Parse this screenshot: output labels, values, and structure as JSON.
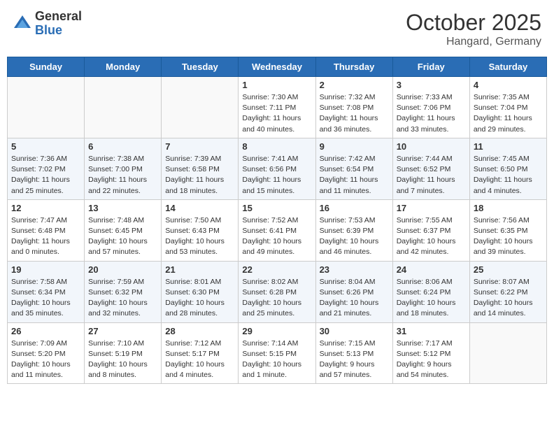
{
  "header": {
    "logo_general": "General",
    "logo_blue": "Blue",
    "month_title": "October 2025",
    "location": "Hangard, Germany"
  },
  "weekdays": [
    "Sunday",
    "Monday",
    "Tuesday",
    "Wednesday",
    "Thursday",
    "Friday",
    "Saturday"
  ],
  "weeks": [
    [
      {
        "day": "",
        "info": ""
      },
      {
        "day": "",
        "info": ""
      },
      {
        "day": "",
        "info": ""
      },
      {
        "day": "1",
        "info": "Sunrise: 7:30 AM\nSunset: 7:11 PM\nDaylight: 11 hours\nand 40 minutes."
      },
      {
        "day": "2",
        "info": "Sunrise: 7:32 AM\nSunset: 7:08 PM\nDaylight: 11 hours\nand 36 minutes."
      },
      {
        "day": "3",
        "info": "Sunrise: 7:33 AM\nSunset: 7:06 PM\nDaylight: 11 hours\nand 33 minutes."
      },
      {
        "day": "4",
        "info": "Sunrise: 7:35 AM\nSunset: 7:04 PM\nDaylight: 11 hours\nand 29 minutes."
      }
    ],
    [
      {
        "day": "5",
        "info": "Sunrise: 7:36 AM\nSunset: 7:02 PM\nDaylight: 11 hours\nand 25 minutes."
      },
      {
        "day": "6",
        "info": "Sunrise: 7:38 AM\nSunset: 7:00 PM\nDaylight: 11 hours\nand 22 minutes."
      },
      {
        "day": "7",
        "info": "Sunrise: 7:39 AM\nSunset: 6:58 PM\nDaylight: 11 hours\nand 18 minutes."
      },
      {
        "day": "8",
        "info": "Sunrise: 7:41 AM\nSunset: 6:56 PM\nDaylight: 11 hours\nand 15 minutes."
      },
      {
        "day": "9",
        "info": "Sunrise: 7:42 AM\nSunset: 6:54 PM\nDaylight: 11 hours\nand 11 minutes."
      },
      {
        "day": "10",
        "info": "Sunrise: 7:44 AM\nSunset: 6:52 PM\nDaylight: 11 hours\nand 7 minutes."
      },
      {
        "day": "11",
        "info": "Sunrise: 7:45 AM\nSunset: 6:50 PM\nDaylight: 11 hours\nand 4 minutes."
      }
    ],
    [
      {
        "day": "12",
        "info": "Sunrise: 7:47 AM\nSunset: 6:48 PM\nDaylight: 11 hours\nand 0 minutes."
      },
      {
        "day": "13",
        "info": "Sunrise: 7:48 AM\nSunset: 6:45 PM\nDaylight: 10 hours\nand 57 minutes."
      },
      {
        "day": "14",
        "info": "Sunrise: 7:50 AM\nSunset: 6:43 PM\nDaylight: 10 hours\nand 53 minutes."
      },
      {
        "day": "15",
        "info": "Sunrise: 7:52 AM\nSunset: 6:41 PM\nDaylight: 10 hours\nand 49 minutes."
      },
      {
        "day": "16",
        "info": "Sunrise: 7:53 AM\nSunset: 6:39 PM\nDaylight: 10 hours\nand 46 minutes."
      },
      {
        "day": "17",
        "info": "Sunrise: 7:55 AM\nSunset: 6:37 PM\nDaylight: 10 hours\nand 42 minutes."
      },
      {
        "day": "18",
        "info": "Sunrise: 7:56 AM\nSunset: 6:35 PM\nDaylight: 10 hours\nand 39 minutes."
      }
    ],
    [
      {
        "day": "19",
        "info": "Sunrise: 7:58 AM\nSunset: 6:34 PM\nDaylight: 10 hours\nand 35 minutes."
      },
      {
        "day": "20",
        "info": "Sunrise: 7:59 AM\nSunset: 6:32 PM\nDaylight: 10 hours\nand 32 minutes."
      },
      {
        "day": "21",
        "info": "Sunrise: 8:01 AM\nSunset: 6:30 PM\nDaylight: 10 hours\nand 28 minutes."
      },
      {
        "day": "22",
        "info": "Sunrise: 8:02 AM\nSunset: 6:28 PM\nDaylight: 10 hours\nand 25 minutes."
      },
      {
        "day": "23",
        "info": "Sunrise: 8:04 AM\nSunset: 6:26 PM\nDaylight: 10 hours\nand 21 minutes."
      },
      {
        "day": "24",
        "info": "Sunrise: 8:06 AM\nSunset: 6:24 PM\nDaylight: 10 hours\nand 18 minutes."
      },
      {
        "day": "25",
        "info": "Sunrise: 8:07 AM\nSunset: 6:22 PM\nDaylight: 10 hours\nand 14 minutes."
      }
    ],
    [
      {
        "day": "26",
        "info": "Sunrise: 7:09 AM\nSunset: 5:20 PM\nDaylight: 10 hours\nand 11 minutes."
      },
      {
        "day": "27",
        "info": "Sunrise: 7:10 AM\nSunset: 5:19 PM\nDaylight: 10 hours\nand 8 minutes."
      },
      {
        "day": "28",
        "info": "Sunrise: 7:12 AM\nSunset: 5:17 PM\nDaylight: 10 hours\nand 4 minutes."
      },
      {
        "day": "29",
        "info": "Sunrise: 7:14 AM\nSunset: 5:15 PM\nDaylight: 10 hours\nand 1 minute."
      },
      {
        "day": "30",
        "info": "Sunrise: 7:15 AM\nSunset: 5:13 PM\nDaylight: 9 hours\nand 57 minutes."
      },
      {
        "day": "31",
        "info": "Sunrise: 7:17 AM\nSunset: 5:12 PM\nDaylight: 9 hours\nand 54 minutes."
      },
      {
        "day": "",
        "info": ""
      }
    ]
  ]
}
